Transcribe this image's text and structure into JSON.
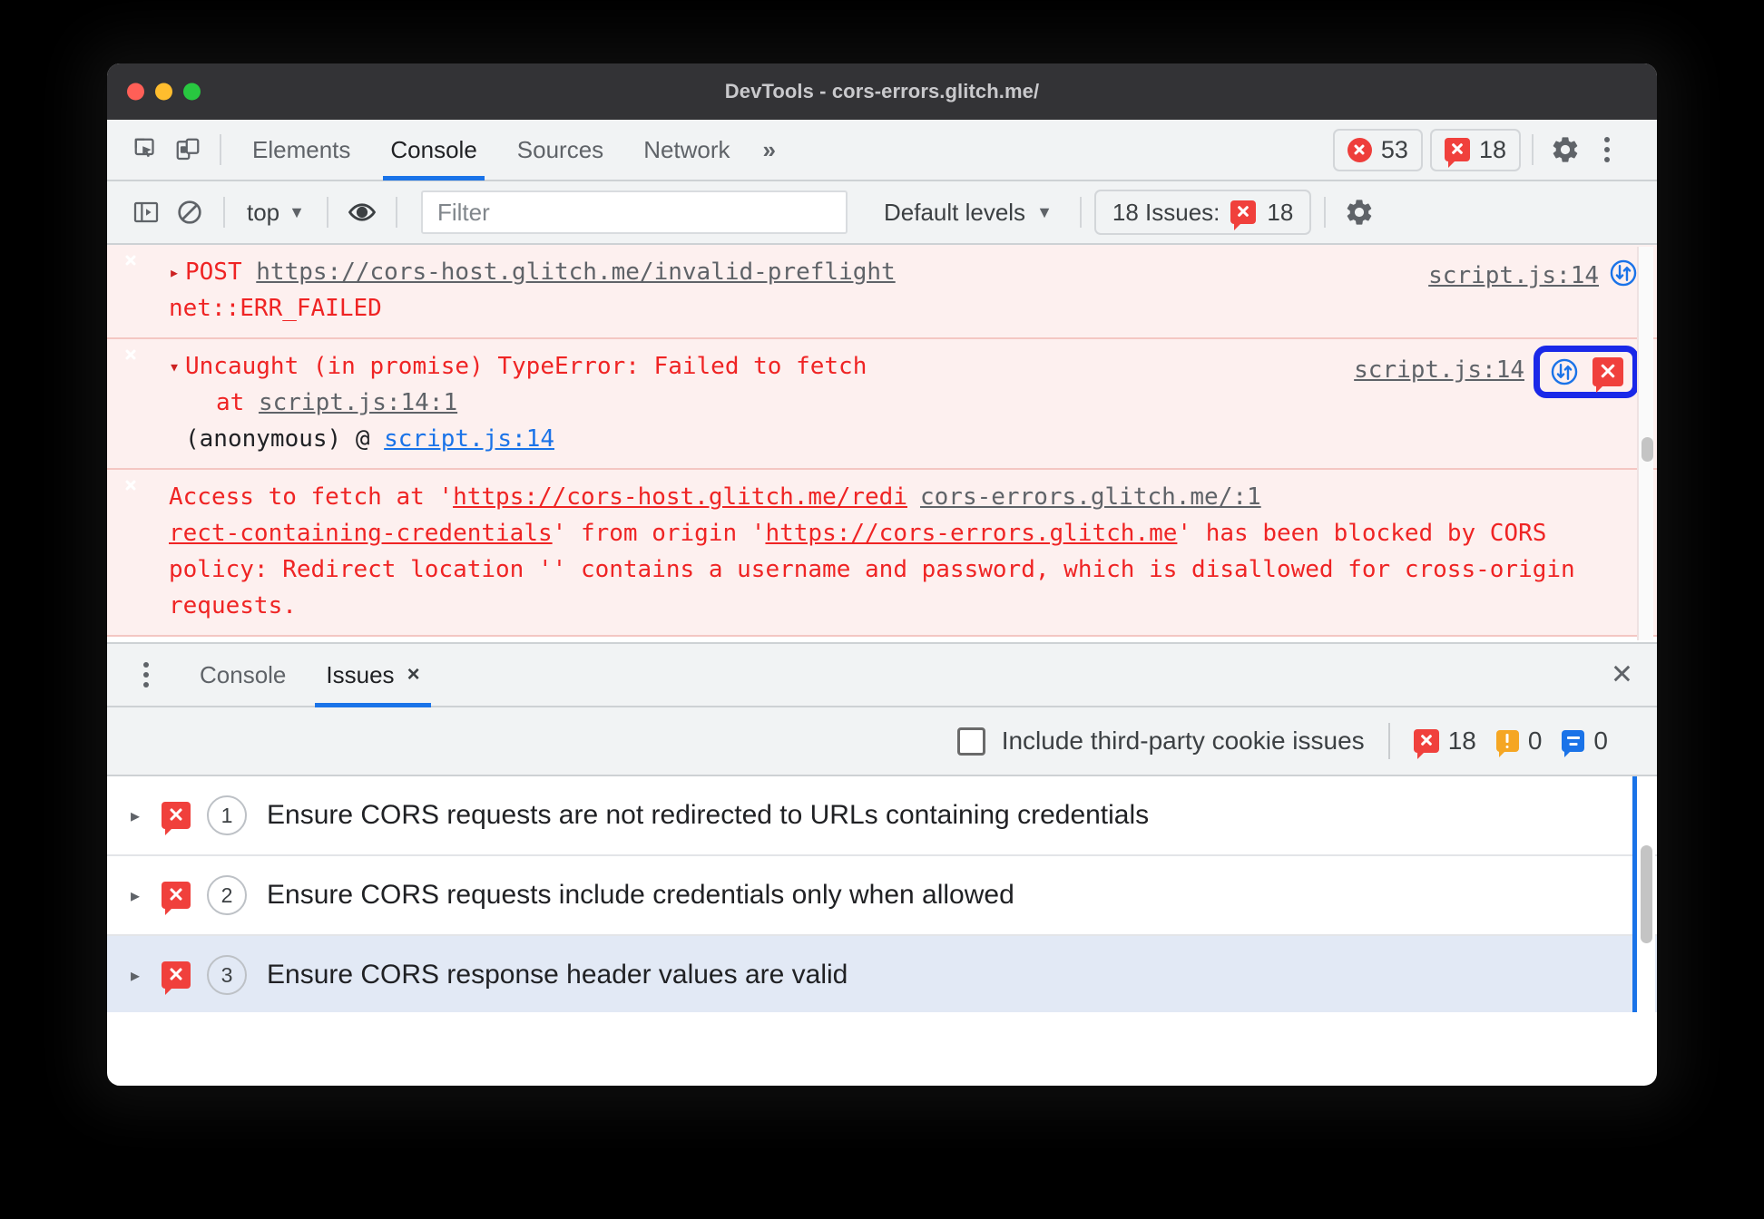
{
  "window": {
    "title": "DevTools - cors-errors.glitch.me/",
    "traffic_lights": [
      "close",
      "minimize",
      "maximize"
    ]
  },
  "main_toolbar": {
    "inspect_icon": "inspect-element-icon",
    "device_icon": "device-toolbar-icon",
    "tabs": [
      {
        "label": "Elements",
        "active": false
      },
      {
        "label": "Console",
        "active": true
      },
      {
        "label": "Sources",
        "active": false
      },
      {
        "label": "Network",
        "active": false
      }
    ],
    "more_tabs_label": "»",
    "error_count": "53",
    "issue_count": "18",
    "settings_icon": "gear-icon",
    "more_options_icon": "kebab-menu-icon"
  },
  "console_toolbar": {
    "sidebar_toggle_icon": "console-sidebar-icon",
    "clear_console_icon": "clear-console-icon",
    "context": "top",
    "context_caret": "▼",
    "eye_icon": "live-expression-eye-icon",
    "filter_placeholder": "Filter",
    "filter_value": "",
    "levels_label": "Default levels",
    "levels_caret": "▼",
    "issues_button_label": "18 Issues:",
    "issues_button_count": "18",
    "settings_icon": "console-settings-gear-icon"
  },
  "console_messages": [
    {
      "id": "msg-post-failed",
      "level": "error",
      "expander": "▸",
      "method": "POST",
      "url": "https://cors-host.glitch.me/invalid-preflight",
      "detail": "net::ERR_FAILED",
      "source": "script.js:14",
      "network_icon": "network-request-icon",
      "highlighted": false
    },
    {
      "id": "msg-uncaught-typeerror",
      "level": "error",
      "expander": "▾",
      "text": "Uncaught (in promise) TypeError: Failed to fetch",
      "stack_prefix": "at ",
      "stack_link": "script.js:14:1",
      "frame_label": "(anonymous) @ ",
      "frame_link": "script.js:14",
      "source": "script.js:14",
      "network_icon": "network-request-icon",
      "issue_icon": "issue-bubble-icon",
      "highlighted": true,
      "highlight_color": "#1a28e8"
    },
    {
      "id": "msg-cors-blocked",
      "level": "error",
      "prefix": "Access to fetch at '",
      "url_part1": "https://cors-host.glitch.me/redi",
      "url_part2": "rect-containing-credentials",
      "mid": "' from origin '",
      "origin": "https://cors-errors.glitch.me",
      "suffix": "' has been blocked by CORS policy: Redirect location '' contains a username and password, which is disallowed for cross-origin requests.",
      "source": "cors-errors.glitch.me/:1"
    }
  ],
  "drawer": {
    "kebab_icon": "drawer-more-options-icon",
    "tabs": [
      {
        "label": "Console",
        "active": false,
        "closable": false
      },
      {
        "label": "Issues",
        "active": true,
        "closable": true,
        "close_glyph": "×"
      }
    ],
    "close_icon": "close-drawer-icon",
    "close_glyph": "✕"
  },
  "issues_filter": {
    "checkbox_label": "Include third-party cookie issues",
    "checkbox_checked": false,
    "error_count": "18",
    "warning_count": "0",
    "info_count": "0"
  },
  "issues": [
    {
      "arrow": "▸",
      "icon": "issue-error-bubble-icon",
      "count": "1",
      "title": "Ensure CORS requests are not redirected to URLs containing credentials",
      "selected": false
    },
    {
      "arrow": "▸",
      "icon": "issue-error-bubble-icon",
      "count": "2",
      "title": "Ensure CORS requests include credentials only when allowed",
      "selected": false
    },
    {
      "arrow": "▸",
      "icon": "issue-error-bubble-icon",
      "count": "3",
      "title": "Ensure CORS response header values are valid",
      "selected": true
    }
  ],
  "colors": {
    "accent": "#1a73e8",
    "error_red": "#ef2424",
    "error_bg": "#fdf0ef",
    "toolbar_bg": "#f1f3f4",
    "titlebar_bg": "#333336",
    "highlight_blue": "#1a28e8"
  }
}
